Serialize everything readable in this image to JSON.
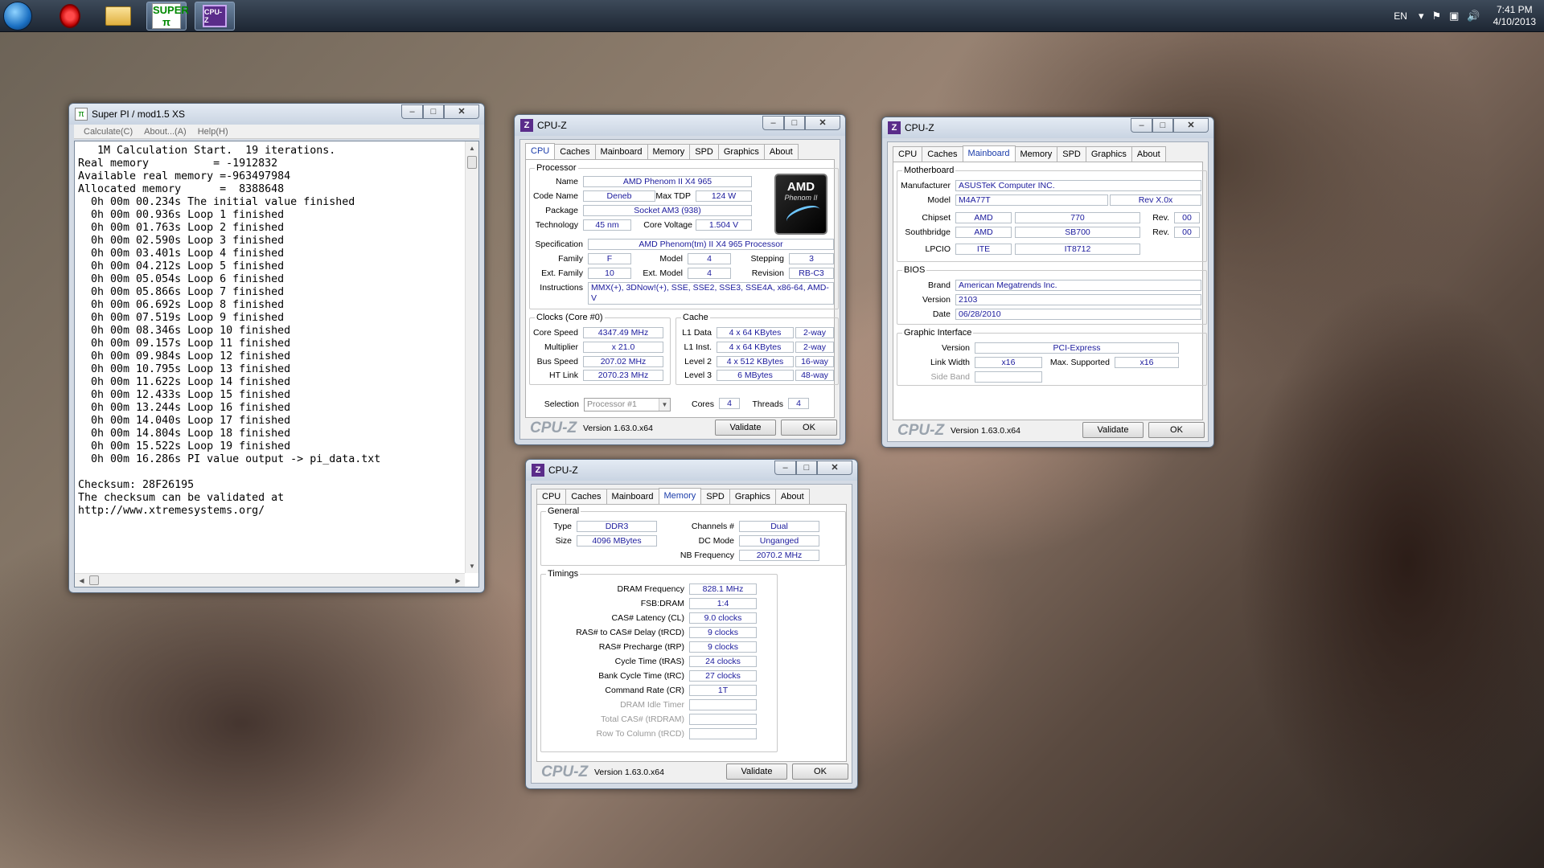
{
  "taskbar": {
    "superpi_icon_text": "SUPER π",
    "cpuz_icon_text": "CPU-Z",
    "lang": "EN",
    "time": "7:41 PM",
    "date": "4/10/2013"
  },
  "superpi": {
    "title": "Super PI / mod1.5 XS",
    "menu": [
      "Calculate(C)",
      "About...(A)",
      "Help(H)"
    ],
    "output": "   1M Calculation Start.  19 iterations.\nReal memory          = -1912832\nAvailable real memory =-963497984\nAllocated memory      =  8388648\n  0h 00m 00.234s The initial value finished\n  0h 00m 00.936s Loop 1 finished\n  0h 00m 01.763s Loop 2 finished\n  0h 00m 02.590s Loop 3 finished\n  0h 00m 03.401s Loop 4 finished\n  0h 00m 04.212s Loop 5 finished\n  0h 00m 05.054s Loop 6 finished\n  0h 00m 05.866s Loop 7 finished\n  0h 00m 06.692s Loop 8 finished\n  0h 00m 07.519s Loop 9 finished\n  0h 00m 08.346s Loop 10 finished\n  0h 00m 09.157s Loop 11 finished\n  0h 00m 09.984s Loop 12 finished\n  0h 00m 10.795s Loop 13 finished\n  0h 00m 11.622s Loop 14 finished\n  0h 00m 12.433s Loop 15 finished\n  0h 00m 13.244s Loop 16 finished\n  0h 00m 14.040s Loop 17 finished\n  0h 00m 14.804s Loop 18 finished\n  0h 00m 15.522s Loop 19 finished\n  0h 00m 16.286s PI value output -> pi_data.txt\n\nChecksum: 28F26195\nThe checksum can be validated at\nhttp://www.xtremesystems.org/"
  },
  "cpuz_common": {
    "title": "CPU-Z",
    "tabs": [
      "CPU",
      "Caches",
      "Mainboard",
      "Memory",
      "SPD",
      "Graphics",
      "About"
    ],
    "brand": "CPU-Z",
    "version": "Version 1.63.0.x64",
    "validate": "Validate",
    "ok": "OK"
  },
  "cpu": {
    "processor_label": "Processor",
    "name_label": "Name",
    "name": "AMD Phenom II X4 965",
    "codename_label": "Code Name",
    "codename": "Deneb",
    "maxtdp_label": "Max TDP",
    "maxtdp": "124 W",
    "package_label": "Package",
    "package": "Socket AM3 (938)",
    "technology_label": "Technology",
    "technology": "45 nm",
    "corevoltage_label": "Core Voltage",
    "corevoltage": "1.504 V",
    "spec_label": "Specification",
    "spec": "AMD Phenom(tm) II X4 965 Processor",
    "family_label": "Family",
    "family": "F",
    "model_label": "Model",
    "model": "4",
    "stepping_label": "Stepping",
    "stepping": "3",
    "extfamily_label": "Ext. Family",
    "extfamily": "10",
    "extmodel_label": "Ext. Model",
    "extmodel": "4",
    "revision_label": "Revision",
    "revision": "RB-C3",
    "instructions_label": "Instructions",
    "instructions": "MMX(+), 3DNow!(+), SSE, SSE2, SSE3, SSE4A, x86-64, AMD-V",
    "logo_brand": "AMD",
    "logo_product": "Phenom II",
    "clocks_label": "Clocks (Core #0)",
    "corespeed_label": "Core Speed",
    "corespeed": "4347.49 MHz",
    "multiplier_label": "Multiplier",
    "multiplier": "x 21.0",
    "busspeed_label": "Bus Speed",
    "busspeed": "207.02 MHz",
    "htlink_label": "HT Link",
    "htlink": "2070.23 MHz",
    "cache_label": "Cache",
    "l1d_label": "L1 Data",
    "l1d": "4 x 64 KBytes",
    "l1d_way": "2-way",
    "l1i_label": "L1 Inst.",
    "l1i": "4 x 64 KBytes",
    "l1i_way": "2-way",
    "l2_label": "Level 2",
    "l2": "4 x 512 KBytes",
    "l2_way": "16-way",
    "l3_label": "Level 3",
    "l3": "6 MBytes",
    "l3_way": "48-way",
    "selection_label": "Selection",
    "selection": "Processor #1",
    "cores_label": "Cores",
    "cores": "4",
    "threads_label": "Threads",
    "threads": "4"
  },
  "mainboard": {
    "motherboard_label": "Motherboard",
    "manufacturer_label": "Manufacturer",
    "manufacturer": "ASUSTeK Computer INC.",
    "model_label": "Model",
    "model": "M4A77T",
    "model_rev": "Rev X.0x",
    "chipset_label": "Chipset",
    "chipset_vendor": "AMD",
    "chipset": "770",
    "chipset_rev_label": "Rev.",
    "chipset_rev": "00",
    "southbridge_label": "Southbridge",
    "sb_vendor": "AMD",
    "sb": "SB700",
    "sb_rev_label": "Rev.",
    "sb_rev": "00",
    "lpcio_label": "LPCIO",
    "lpcio_vendor": "ITE",
    "lpcio": "IT8712",
    "bios_label": "BIOS",
    "brand_label": "Brand",
    "brand": "American Megatrends Inc.",
    "version_label": "Version",
    "version": "2103",
    "date_label": "Date",
    "date": "06/28/2010",
    "gi_label": "Graphic Interface",
    "gi_version_label": "Version",
    "gi_version": "PCI-Express",
    "linkwidth_label": "Link Width",
    "linkwidth": "x16",
    "maxsupported_label": "Max. Supported",
    "maxsupported": "x16",
    "sideband_label": "Side Band"
  },
  "memory": {
    "general_label": "General",
    "type_label": "Type",
    "type": "DDR3",
    "size_label": "Size",
    "size": "4096 MBytes",
    "channels_label": "Channels #",
    "channels": "Dual",
    "dcmode_label": "DC Mode",
    "dcmode": "Unganged",
    "nbfreq_label": "NB Frequency",
    "nbfreq": "2070.2 MHz",
    "timings_label": "Timings",
    "timings": [
      {
        "label": "DRAM Frequency",
        "value": "828.1 MHz"
      },
      {
        "label": "FSB:DRAM",
        "value": "1:4"
      },
      {
        "label": "CAS# Latency (CL)",
        "value": "9.0 clocks"
      },
      {
        "label": "RAS# to CAS# Delay (tRCD)",
        "value": "9 clocks"
      },
      {
        "label": "RAS# Precharge (tRP)",
        "value": "9 clocks"
      },
      {
        "label": "Cycle Time (tRAS)",
        "value": "24 clocks"
      },
      {
        "label": "Bank Cycle Time (tRC)",
        "value": "27 clocks"
      },
      {
        "label": "Command Rate (CR)",
        "value": "1T"
      },
      {
        "label": "DRAM Idle Timer",
        "value": ""
      },
      {
        "label": "Total CAS# (tRDRAM)",
        "value": ""
      },
      {
        "label": "Row To Column (tRCD)",
        "value": ""
      }
    ]
  }
}
